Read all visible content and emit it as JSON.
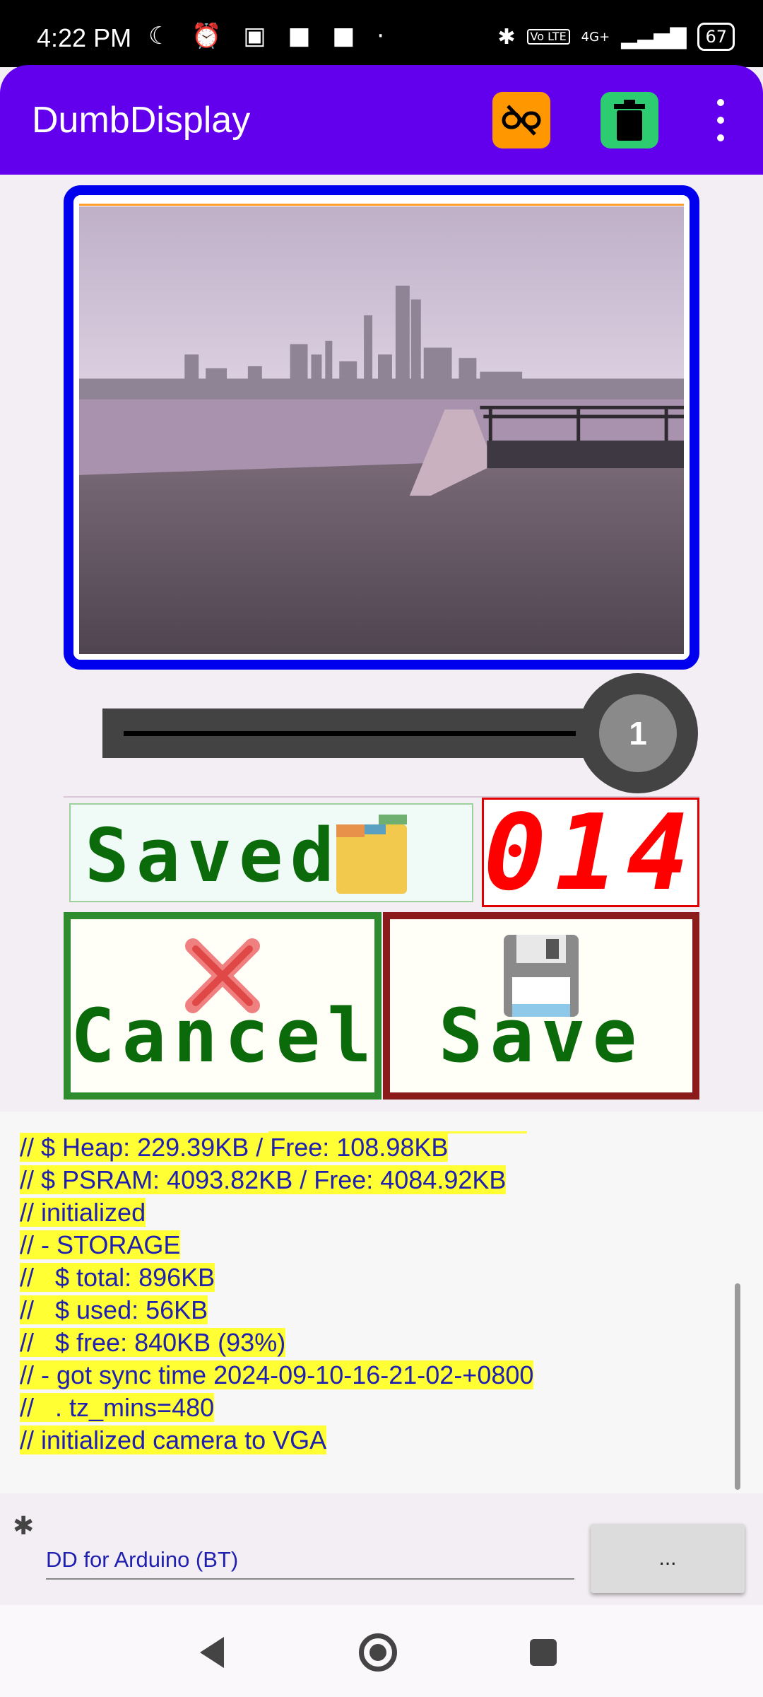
{
  "status_bar": {
    "time": "4:22 PM",
    "left_icons": "☾ ⏰ ▣ ■ ■ ·",
    "volte": "Vo LTE",
    "network": "4G+",
    "battery": "67"
  },
  "app_bar": {
    "title": "DumbDisplay",
    "unlink_icon": "link-off-icon",
    "delete_icon": "trash-icon",
    "more_icon": "more-vert-icon",
    "accent_color": "#6200ee"
  },
  "camera": {
    "frame_color": "#0000ee"
  },
  "slider": {
    "knob_label": "1"
  },
  "status_panel": {
    "label": "Saved",
    "counter": "014",
    "counter_color": "#ff0000",
    "text_color": "#0b6b0b"
  },
  "buttons": {
    "cancel_label": "Cancel",
    "save_label": "Save",
    "cancel_border": "#2e8b2e",
    "save_border": "#8b1a1a"
  },
  "terminal": {
    "lines": [
      "// $ Heap: 229.39KB / Free: 108.98KB",
      "// $ PSRAM: 4093.82KB / Free: 4084.92KB",
      "// initialized",
      "// - STORAGE",
      "//   $ total: 896KB",
      "//   $ used: 56KB",
      "//   $ free: 840KB (93%)",
      "// - got sync time 2024-09-10-16-21-02-+0800",
      "//   . tz_mins=480",
      "// initialized camera to VGA"
    ]
  },
  "connection": {
    "value": "DD for Arduino (BT)",
    "more_label": "..."
  }
}
